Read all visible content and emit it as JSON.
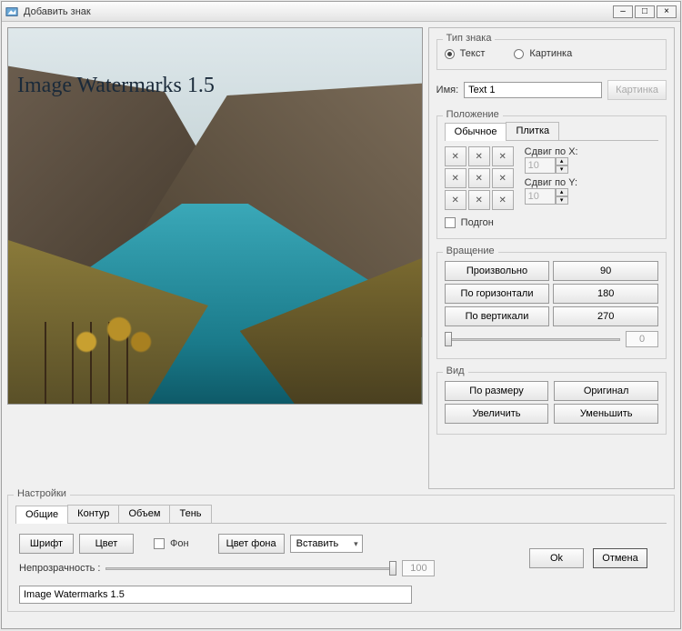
{
  "window": {
    "title": "Добавить знак"
  },
  "preview": {
    "watermark_text": "Image Watermarks 1.5"
  },
  "type_group": {
    "legend": "Тип знака",
    "text_label": "Текст",
    "image_label": "Картинка",
    "selected": "text"
  },
  "name": {
    "label": "Имя:",
    "value": "Text 1",
    "picture_btn": "Картинка"
  },
  "position": {
    "legend": "Положение",
    "tabs": {
      "normal": "Обычное",
      "tile": "Плитка"
    },
    "shift_x_label": "Сдвиг по X:",
    "shift_x_value": "10",
    "shift_y_label": "Сдвиг по Y:",
    "shift_y_value": "10",
    "fit_label": "Подгон"
  },
  "rotation": {
    "legend": "Вращение",
    "arbitrary": "Произвольно",
    "deg90": "90",
    "horizontal": "По горизонтали",
    "deg180": "180",
    "vertical": "По вертикали",
    "deg270": "270",
    "slider_value": "0"
  },
  "view": {
    "legend": "Вид",
    "fit": "По размеру",
    "original": "Оригинал",
    "zoom_in": "Увеличить",
    "zoom_out": "Уменьшить"
  },
  "settings": {
    "legend": "Настройки",
    "tabs": {
      "general": "Общие",
      "outline": "Контур",
      "volume": "Объем",
      "shadow": "Тень"
    },
    "font_btn": "Шрифт",
    "color_btn": "Цвет",
    "bg_check": "Фон",
    "bg_color_btn": "Цвет фона",
    "insert_select": "Вставить",
    "opacity_label": "Непрозрачность :",
    "opacity_value": "100",
    "text_value": "Image Watermarks 1.5"
  },
  "dialog": {
    "ok": "Ok",
    "cancel": "Отмена"
  }
}
